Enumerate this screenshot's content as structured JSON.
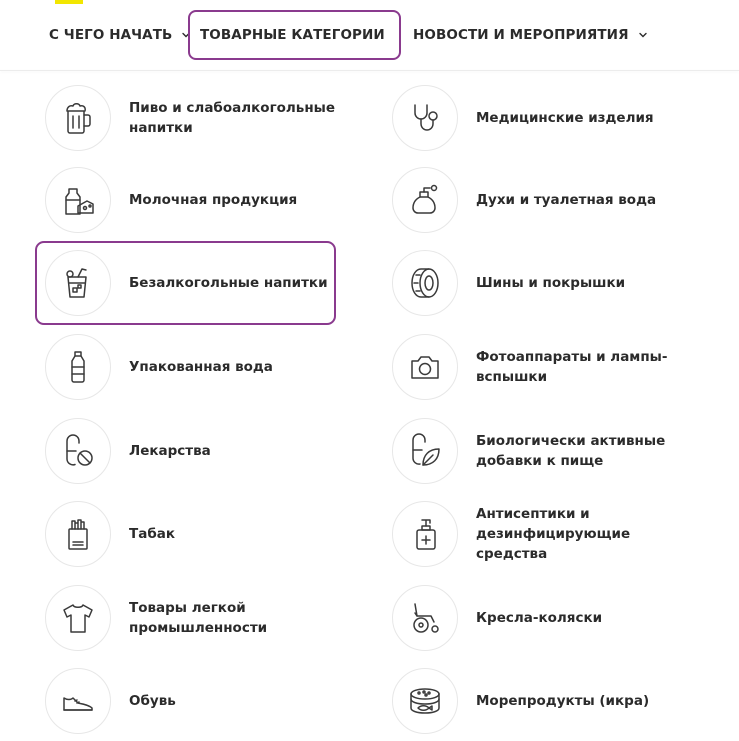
{
  "nav": {
    "item1": "С ЧЕГО НАЧАТЬ",
    "item2": "ТОВАРНЫЕ КАТЕГОРИИ",
    "item3": "НОВОСТИ И МЕРОПРИЯТИЯ"
  },
  "categories_left": [
    {
      "label": "Пиво и слабоалкогольные напитки",
      "icon": "beer-mug-icon"
    },
    {
      "label": "Молочная продукция",
      "icon": "dairy-icon"
    },
    {
      "label": "Безалкогольные напитки",
      "icon": "soft-drink-icon"
    },
    {
      "label": "Упакованная вода",
      "icon": "water-bottle-icon"
    },
    {
      "label": "Лекарства",
      "icon": "medicine-icon"
    },
    {
      "label": "Табак",
      "icon": "tobacco-icon"
    },
    {
      "label": "Товары легкой промышленности",
      "icon": "tshirt-icon"
    },
    {
      "label": "Обувь",
      "icon": "shoe-icon"
    }
  ],
  "categories_right": [
    {
      "label": "Медицинские изделия",
      "icon": "stethoscope-icon"
    },
    {
      "label": "Духи и туалетная вода",
      "icon": "perfume-icon"
    },
    {
      "label": "Шины и покрышки",
      "icon": "tire-icon"
    },
    {
      "label": "Фотоаппараты и лампы-вспышки",
      "icon": "camera-icon"
    },
    {
      "label": "Биологически активные добавки к пище",
      "icon": "supplement-icon"
    },
    {
      "label": "Антисептики и дезинфицирующие средства",
      "icon": "antiseptic-icon"
    },
    {
      "label": "Кресла-коляски",
      "icon": "wheelchair-icon"
    },
    {
      "label": "Морепродукты (икра)",
      "icon": "caviar-icon"
    }
  ],
  "colors": {
    "accent": "#8a3a8e",
    "brand_yellow": "#f2e600"
  }
}
